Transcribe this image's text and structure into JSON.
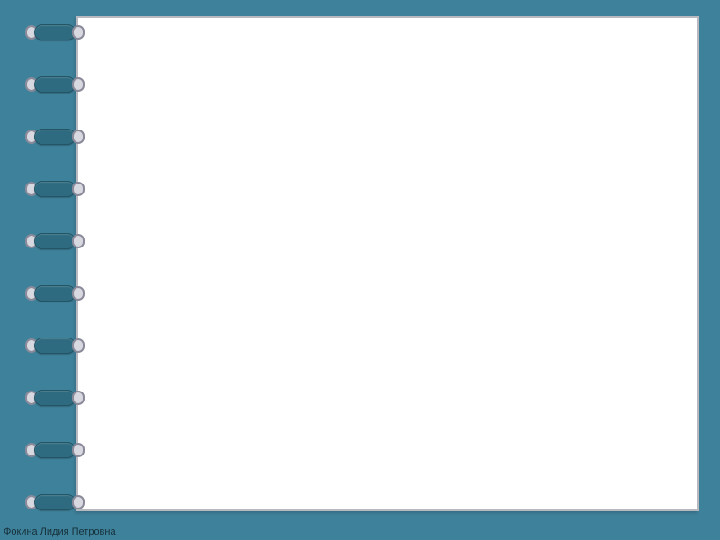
{
  "colors": {
    "background": "#3e819a",
    "page": "#ffffff",
    "page_border": "#b8b8c0",
    "ring_tab": "#2f6b80"
  },
  "spiral": {
    "ring_count": 10
  },
  "footer": {
    "author": "Фокина Лидия Петровна"
  }
}
